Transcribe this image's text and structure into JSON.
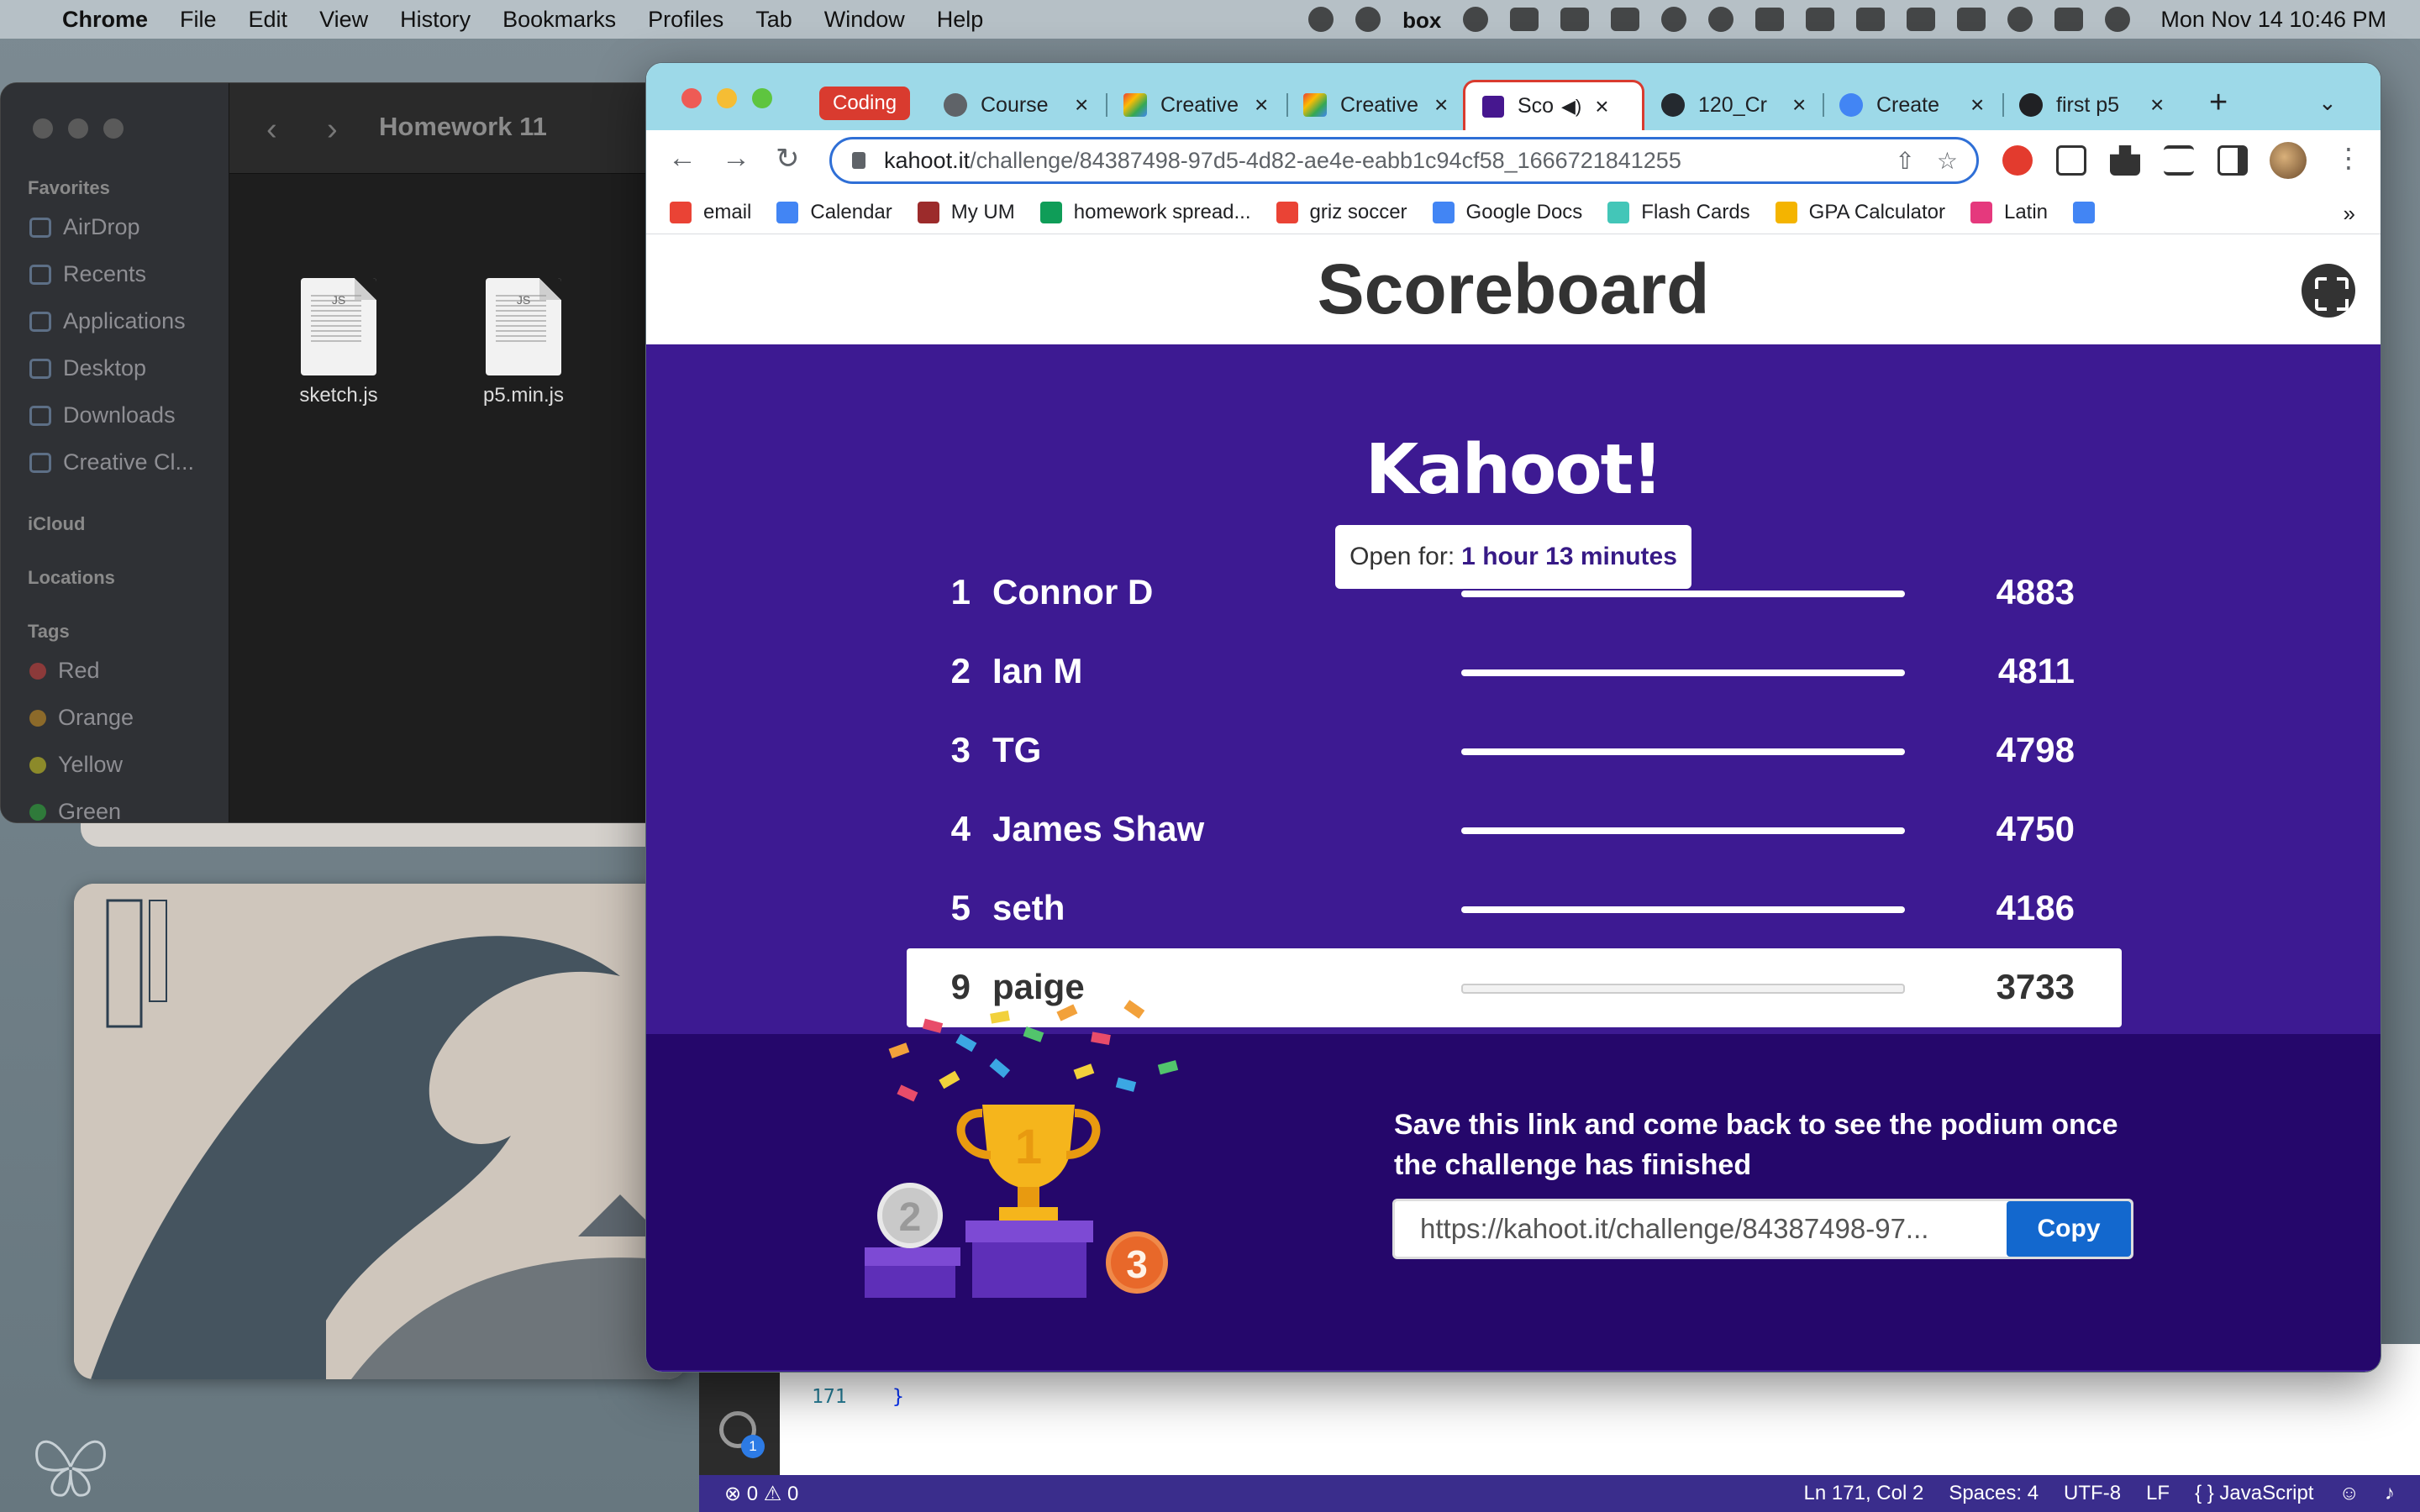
{
  "menubar": {
    "app": "Chrome",
    "items": [
      "File",
      "Edit",
      "View",
      "History",
      "Bookmarks",
      "Profiles",
      "Tab",
      "Window",
      "Help"
    ],
    "box_label": "box",
    "clock": "Mon Nov 14  10:46 PM"
  },
  "finder": {
    "folder_title": "Homework 11",
    "sections": {
      "favorites": "Favorites",
      "icloud": "iCloud",
      "locations": "Locations",
      "tags": "Tags"
    },
    "favorites": [
      "AirDrop",
      "Recents",
      "Applications",
      "Desktop",
      "Downloads",
      "Creative Cl..."
    ],
    "tags": [
      {
        "label": "Red",
        "color": "#8c3a3a"
      },
      {
        "label": "Orange",
        "color": "#8c6a2a"
      },
      {
        "label": "Yellow",
        "color": "#8c8a2a"
      },
      {
        "label": "Green",
        "color": "#2f7a3a"
      }
    ],
    "files": [
      {
        "name": "sketch.js",
        "ext": "JS"
      },
      {
        "name": "p5.min.js",
        "ext": "JS"
      }
    ]
  },
  "chrome": {
    "tab_group_label": "Coding",
    "tabs": [
      {
        "label": "Course",
        "favicon_color": "#5f6368"
      },
      {
        "label": "Creative",
        "favicon_color": "#e94235"
      },
      {
        "label": "Creative",
        "favicon_color": "#e94235"
      },
      {
        "label": "Sco",
        "favicon_color": "#46178f",
        "active": true
      },
      {
        "label": "120_Cr",
        "favicon_color": "#24292f"
      },
      {
        "label": "Create",
        "favicon_color": "#4285f4"
      },
      {
        "label": "first p5",
        "favicon_color": "#202124"
      }
    ],
    "url_host": "kahoot.it",
    "url_path": "/challenge/84387498-97d5-4d82-ae4e-eabb1c94cf58_1666721841255",
    "bookmarks": [
      {
        "label": "email",
        "color": "#ea4335"
      },
      {
        "label": "Calendar",
        "color": "#4285f4"
      },
      {
        "label": "My UM",
        "color": "#9c2b2b"
      },
      {
        "label": "homework spread...",
        "color": "#0f9d58"
      },
      {
        "label": "griz soccer",
        "color": "#ea4335"
      },
      {
        "label": "Google Docs",
        "color": "#4285f4"
      },
      {
        "label": "Flash Cards",
        "color": "#43c6b8"
      },
      {
        "label": "GPA Calculator",
        "color": "#f4b400"
      },
      {
        "label": "Latin",
        "color": "#e5397d"
      }
    ],
    "more_label": "»"
  },
  "page": {
    "title": "Scoreboard",
    "logo": "Kahoot!",
    "open_for_label": "Open for:",
    "open_for_value": "1 hour 13 minutes",
    "max_score": 4883,
    "rows": [
      {
        "rank": "1",
        "name": "Connor D",
        "score": "4883",
        "progress": 1.0
      },
      {
        "rank": "2",
        "name": "Ian M",
        "score": "4811",
        "progress": 1.0
      },
      {
        "rank": "3",
        "name": "TG",
        "score": "4798",
        "progress": 1.0
      },
      {
        "rank": "4",
        "name": "James Shaw",
        "score": "4750",
        "progress": 1.0
      },
      {
        "rank": "5",
        "name": "seth",
        "score": "4186",
        "progress": 1.0
      },
      {
        "rank": "9",
        "name": "paige",
        "score": "3733",
        "progress": 1.0,
        "highlight": true
      }
    ],
    "save_message": "Save this link and come back to see the podium once the challenge has finished",
    "link_value": "https://kahoot.it/challenge/84387498-97...",
    "copy_label": "Copy",
    "podium_labels": [
      "1",
      "2",
      "3"
    ]
  },
  "vscode": {
    "line_numbers": [
      "171"
    ],
    "code_line": "}",
    "status_left": "⊗ 0 ⚠ 0",
    "status_right": [
      "Ln 171, Col 2",
      "Spaces: 4",
      "UTF-8",
      "LF",
      "{ } JavaScript"
    ],
    "badge": "1"
  }
}
